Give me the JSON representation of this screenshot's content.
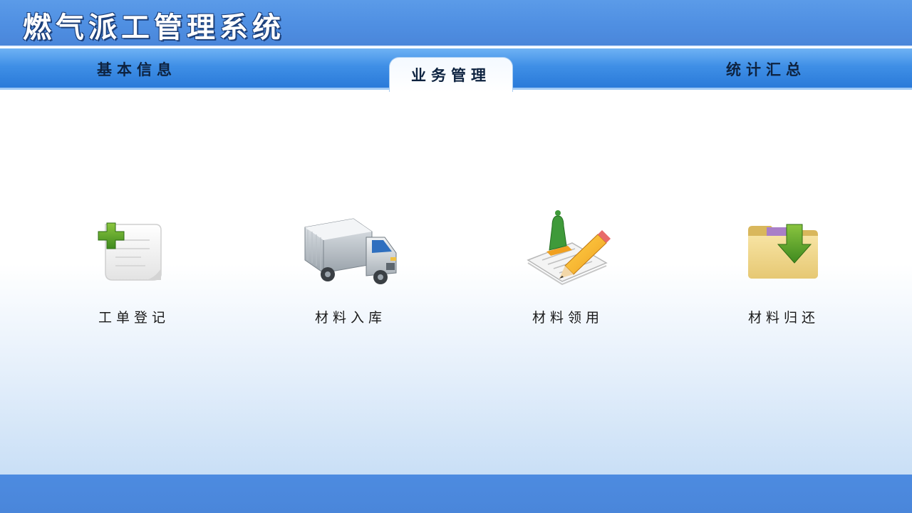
{
  "app": {
    "title": "燃气派工管理系统"
  },
  "nav": {
    "tabs": [
      {
        "label": "基本信息",
        "active": false
      },
      {
        "label": "业务管理",
        "active": true
      },
      {
        "label": "统计汇总",
        "active": false
      }
    ]
  },
  "functions": [
    {
      "label": "工单登记",
      "icon": "add-document-icon"
    },
    {
      "label": "材料入库",
      "icon": "truck-icon"
    },
    {
      "label": "材料领用",
      "icon": "pencil-edit-icon"
    },
    {
      "label": "材料归还",
      "icon": "folder-download-icon"
    }
  ],
  "colors": {
    "title_bar": "#4f8fe2",
    "nav_bar": "#3f8fe6",
    "footer_bar": "#4a86da",
    "text": "#1a1a1a"
  }
}
